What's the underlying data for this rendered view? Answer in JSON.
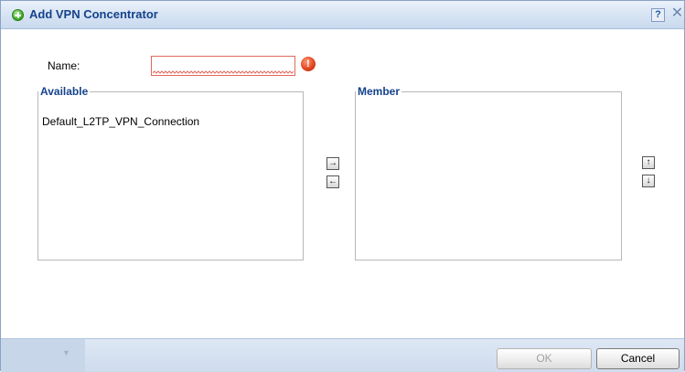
{
  "dialog": {
    "title": "Add VPN Concentrator",
    "help_glyph": "?",
    "close_glyph": "✕"
  },
  "form": {
    "name_label": "Name:",
    "name_value": "",
    "error_glyph": "!"
  },
  "available": {
    "legend": "Available",
    "items": [
      "Default_L2TP_VPN_Connection"
    ]
  },
  "member": {
    "legend": "Member",
    "items": []
  },
  "transfer_buttons": {
    "add_glyph": "→",
    "remove_glyph": "←",
    "up_glyph": "↑",
    "down_glyph": "↓"
  },
  "footer": {
    "ok_label": "OK",
    "cancel_label": "Cancel"
  },
  "icons": {
    "title": "add-circle-icon",
    "error": "error-alert-icon",
    "help": "help-icon",
    "close": "close-icon"
  },
  "colors": {
    "title_text": "#15428b",
    "legend_text": "#15428b",
    "error_border": "#e2675b",
    "titlebar": "#d6e3f3",
    "footer": "#cfdcee"
  }
}
